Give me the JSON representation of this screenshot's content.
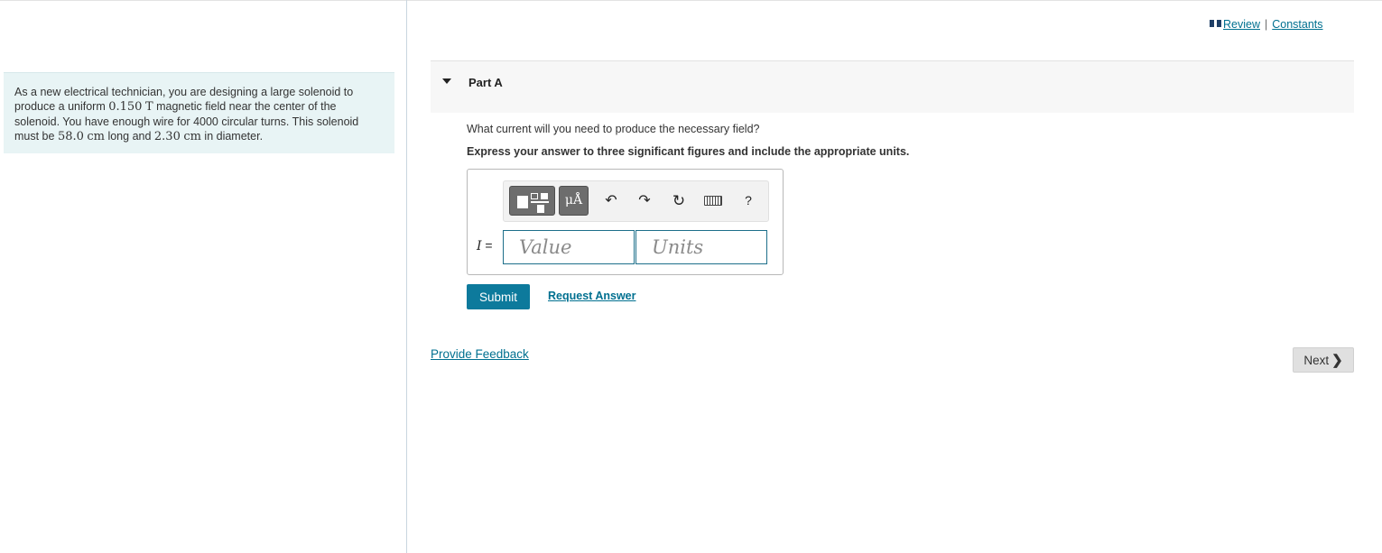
{
  "problem": {
    "text_1": "As a new electrical technician, you are designing a large solenoid to produce a uniform ",
    "field_value": "0.150",
    "field_unit": "T",
    "text_2": " magnetic field near the center of the solenoid. You have enough wire for 4000 circular turns. This solenoid must be ",
    "length_value": "58.0",
    "length_unit": "cm",
    "text_3": " long and ",
    "diameter_value": "2.30",
    "diameter_unit": "cm",
    "text_4": " in diameter."
  },
  "top_links": {
    "review": "Review",
    "separator": "|",
    "constants": "Constants"
  },
  "part": {
    "title": "Part A",
    "question": "What current will you need to produce the necessary field?",
    "instruction": "Express your answer to three significant figures and include the appropriate units."
  },
  "toolbar": {
    "units_label": "μÅ",
    "undo_glyph": "↶",
    "redo_glyph": "↷",
    "reset_glyph": "↻",
    "help_label": "?"
  },
  "answer": {
    "variable": "I",
    "equals": "=",
    "value_placeholder": "Value",
    "units_placeholder": "Units",
    "value": "",
    "units": ""
  },
  "actions": {
    "submit": "Submit",
    "request_answer": "Request Answer",
    "provide_feedback": "Provide Feedback",
    "next": "Next",
    "next_glyph": "❯"
  },
  "colors": {
    "accent": "#0d7a9c",
    "link": "#007090",
    "problem_bg": "#e8f4f5"
  },
  "icons": [
    "book-icon",
    "caret-down-icon",
    "template-icon",
    "undo-icon",
    "redo-icon",
    "reset-icon",
    "keyboard-icon",
    "help-icon",
    "chevron-right-icon"
  ]
}
